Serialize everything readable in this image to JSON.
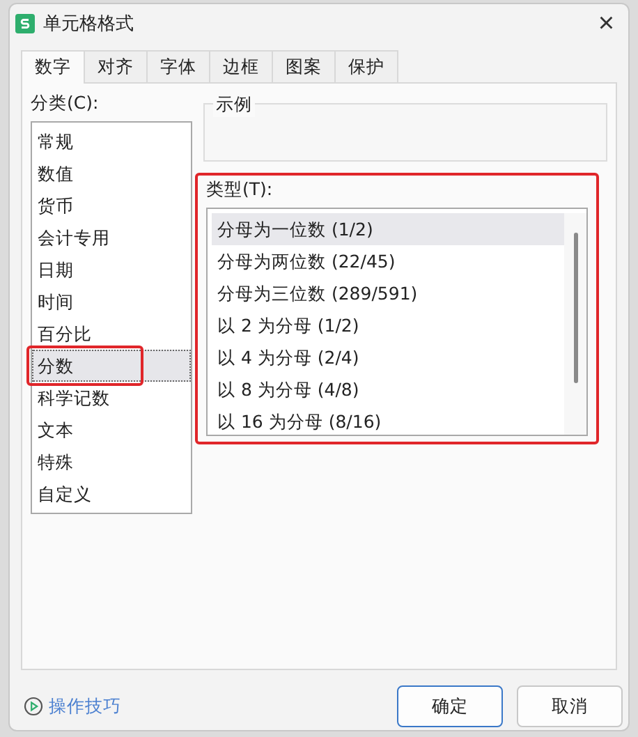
{
  "window": {
    "title": "单元格格式",
    "close": "×"
  },
  "tabs": [
    {
      "label": "数字",
      "selected": true
    },
    {
      "label": "对齐",
      "selected": false
    },
    {
      "label": "字体",
      "selected": false
    },
    {
      "label": "边框",
      "selected": false
    },
    {
      "label": "图案",
      "selected": false
    },
    {
      "label": "保护",
      "selected": false
    }
  ],
  "category": {
    "label": "分类(C):",
    "items": [
      {
        "label": "常规",
        "selected": false,
        "highlighted": false
      },
      {
        "label": "数值",
        "selected": false,
        "highlighted": false
      },
      {
        "label": "货币",
        "selected": false,
        "highlighted": false
      },
      {
        "label": "会计专用",
        "selected": false,
        "highlighted": false
      },
      {
        "label": "日期",
        "selected": false,
        "highlighted": false
      },
      {
        "label": "时间",
        "selected": false,
        "highlighted": false
      },
      {
        "label": "百分比",
        "selected": false,
        "highlighted": false
      },
      {
        "label": "分数",
        "selected": true,
        "highlighted": true
      },
      {
        "label": "科学记数",
        "selected": false,
        "highlighted": false
      },
      {
        "label": "文本",
        "selected": false,
        "highlighted": false
      },
      {
        "label": "特殊",
        "selected": false,
        "highlighted": false
      },
      {
        "label": "自定义",
        "selected": false,
        "highlighted": false
      }
    ]
  },
  "sample": {
    "label": "示例"
  },
  "type": {
    "label": "类型(T):",
    "highlighted": true,
    "items": [
      {
        "label": "分母为一位数 (1/2)",
        "selected": true
      },
      {
        "label": "分母为两位数 (22/45)",
        "selected": false
      },
      {
        "label": "分母为三位数 (289/591)",
        "selected": false
      },
      {
        "label": "以 2 为分母 (1/2)",
        "selected": false
      },
      {
        "label": "以 4 为分母 (2/4)",
        "selected": false
      },
      {
        "label": "以 8 为分母 (4/8)",
        "selected": false
      },
      {
        "label": "以 16 为分母 (8/16)",
        "selected": false
      }
    ]
  },
  "tips_link": "操作技巧",
  "buttons": [
    {
      "label": "确定",
      "default": true
    },
    {
      "label": "取消",
      "default": false
    }
  ]
}
